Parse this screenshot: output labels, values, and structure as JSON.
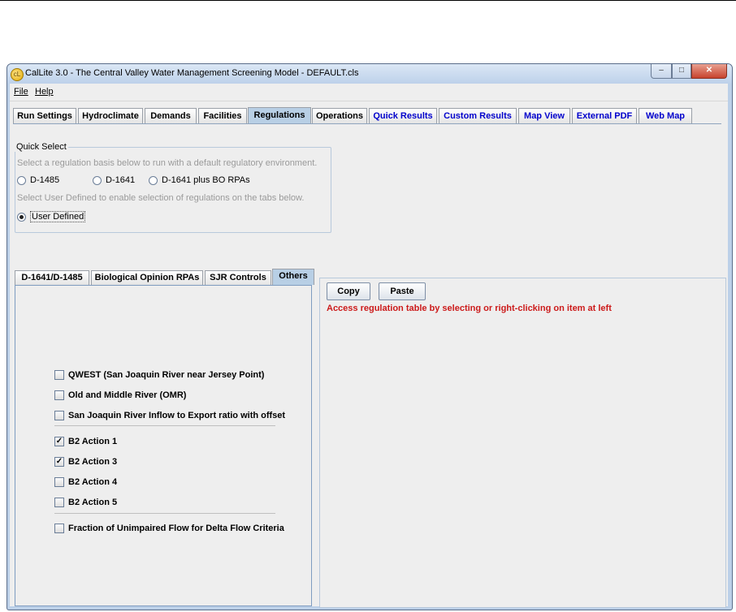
{
  "window": {
    "title": "CalLite 3.0 -  The Central Valley Water Management Screening Model - DEFAULT.cls",
    "icon_text": "cL"
  },
  "menu": [
    {
      "label": "File",
      "mnemonic": "F"
    },
    {
      "label": "Help",
      "mnemonic": "H"
    }
  ],
  "tabs": [
    {
      "label": "Run Settings"
    },
    {
      "label": "Hydroclimate"
    },
    {
      "label": "Demands"
    },
    {
      "label": "Facilities"
    },
    {
      "label": "Regulations",
      "selected": true
    },
    {
      "label": "Operations"
    },
    {
      "label": "Quick Results"
    },
    {
      "label": "Custom Results"
    },
    {
      "label": "Map View"
    },
    {
      "label": "External PDF"
    },
    {
      "label": "Web Map"
    }
  ],
  "quick_select": {
    "title": "Quick Select",
    "hint1": "Select a regulation basis below to run with a default regulatory environment.",
    "options": [
      "D-1485",
      "D-1641",
      "D-1641 plus BO RPAs"
    ],
    "hint2": "Select User Defined to enable selection of regulations on the tabs below.",
    "user_defined": "User Defined",
    "selected": "User Defined"
  },
  "subtabs": [
    {
      "label": "D-1641/D-1485"
    },
    {
      "label": "Biological Opinion RPAs"
    },
    {
      "label": "SJR Controls"
    },
    {
      "label": "Others",
      "selected": true
    }
  ],
  "checkboxes": {
    "group1": [
      {
        "label": "QWEST (San Joaquin River near Jersey Point)",
        "checked": false
      },
      {
        "label": "Old and Middle River (OMR)",
        "checked": false
      },
      {
        "label": "San Joaquin River Inflow to Export ratio with offset",
        "checked": false
      }
    ],
    "group2": [
      {
        "label": "B2 Action 1",
        "checked": true
      },
      {
        "label": "B2 Action 3",
        "checked": true
      },
      {
        "label": "B2 Action 4",
        "checked": false
      },
      {
        "label": "B2 Action 5",
        "checked": false
      }
    ],
    "group3": [
      {
        "label": "Fraction of Unimpaired Flow for Delta Flow Criteria",
        "checked": false
      }
    ]
  },
  "right_panel": {
    "copy_label": "Copy",
    "paste_label": "Paste",
    "message": "Access regulation table by selecting or right-clicking on item at left",
    "message_color": "#cc1b1b"
  },
  "colors": {
    "link_tab": "#0000cc",
    "selected_tab": "#b8cfe5"
  }
}
